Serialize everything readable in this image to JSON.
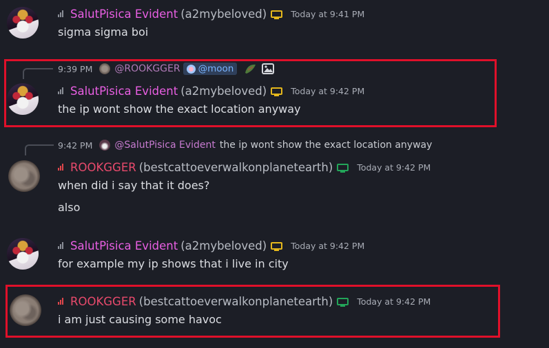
{
  "colors": {
    "background": "#1c1e26",
    "salut_name": "#e95fe3",
    "rook_name": "#e84a6c",
    "highlight": "#e0102a",
    "device_desktop_salut": "#e5b81c",
    "device_desktop_rook": "#23a559"
  },
  "messages": [
    {
      "author": "SalutPisica Evident",
      "handle": "(a2mybeloved)",
      "time": "Today at 9:41 PM",
      "text": "sigma sigma boi"
    },
    {
      "reply": {
        "time": "9:39 PM",
        "author": "@ROOKGGER",
        "mention": "@moon"
      },
      "author": "SalutPisica Evident",
      "handle": "(a2mybeloved)",
      "time": "Today at 9:42 PM",
      "text": "the ip wont show the exact location anyway"
    },
    {
      "reply": {
        "time": "9:42 PM",
        "author": "@SalutPisica Evident",
        "text": "the ip wont show the exact location anyway"
      },
      "author": "ROOKGGER",
      "handle": "(bestcattoeverwalkonplanetearth)",
      "time": "Today at 9:42 PM",
      "text": "when did i say that it does?",
      "text2": "also"
    },
    {
      "author": "SalutPisica Evident",
      "handle": "(a2mybeloved)",
      "time": "Today at 9:42 PM",
      "text": "for example my ip shows that i live in city"
    },
    {
      "author": "ROOKGGER",
      "handle": "(bestcattoeverwalkonplanetearth)",
      "time": "Today at 9:42 PM",
      "text": "i am just causing some havoc"
    }
  ]
}
